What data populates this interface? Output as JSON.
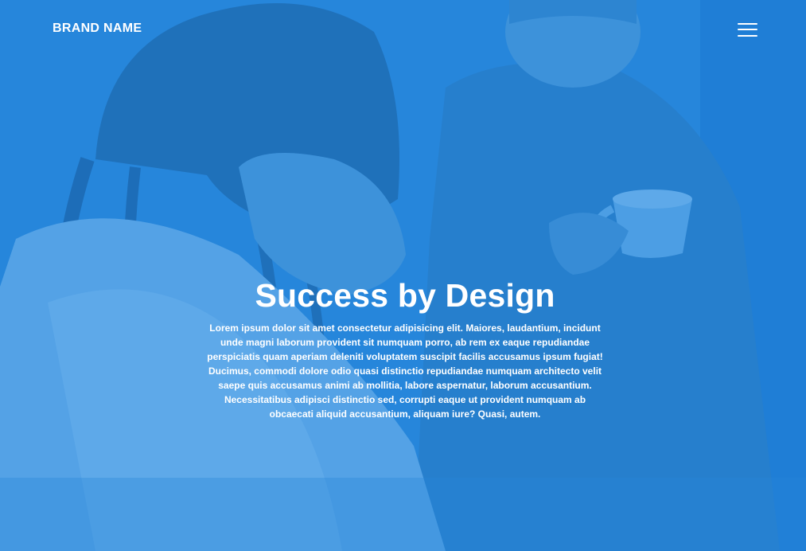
{
  "nav": {
    "brand": "BRAND NAME",
    "menu_icon": "hamburger-menu-icon"
  },
  "hero": {
    "headline": "Success by Design",
    "body": "Lorem ipsum dolor sit amet consectetur adipisicing elit. Maiores, laudantium, incidunt unde magni laborum provident sit numquam porro, ab rem ex eaque repudiandae perspiciatis quam aperiam deleniti voluptatem suscipit facilis accusamus ipsum fugiat! Ducimus, commodi dolore odio quasi distinctio repudiandae numquam architecto velit saepe quis accusamus animi ab mollitia, labore aspernatur, laborum accusantium. Necessitatibus adipisci distinctio sed, corrupti eaque ut provident numquam ab obcaecati aliquid accusantium, aliquam iure? Quasi, autem."
  },
  "colors": {
    "overlay": "#1680de",
    "text": "#ffffff"
  }
}
